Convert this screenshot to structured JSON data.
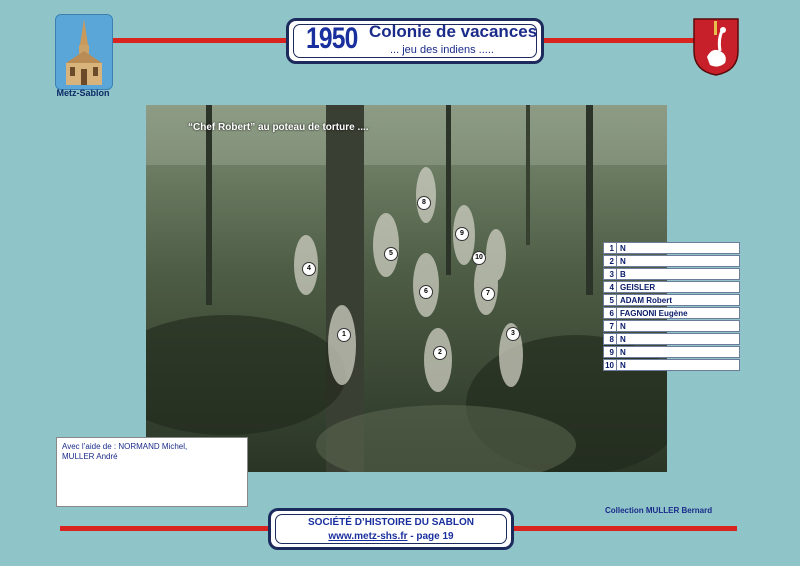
{
  "header": {
    "year": "1950",
    "title": "Colonie de vacances",
    "subtitle": "... jeu des indiens .....",
    "left_logo_caption": "Metz-Sablon"
  },
  "photo": {
    "caption": "“Chef Robert” au poteau de torture ....",
    "markers": [
      "1",
      "2",
      "3",
      "4",
      "5",
      "6",
      "7",
      "8",
      "9",
      "10"
    ]
  },
  "legend": [
    {
      "num": "1",
      "name": "N"
    },
    {
      "num": "2",
      "name": "N"
    },
    {
      "num": "3",
      "name": "B"
    },
    {
      "num": "4",
      "name": "GEISLER"
    },
    {
      "num": "5",
      "name": "ADAM Robert"
    },
    {
      "num": "6",
      "name": "FAGNONI Eugène"
    },
    {
      "num": "7",
      "name": "N"
    },
    {
      "num": "8",
      "name": "N"
    },
    {
      "num": "9",
      "name": "N"
    },
    {
      "num": "10",
      "name": "N"
    }
  ],
  "help": {
    "line1": "Avec l’aide de : NORMAND Michel,",
    "line2": "MULLER André"
  },
  "collection": "Collection MULLER Bernard",
  "footer": {
    "society": "SOCIÉTÉ D’HISTOIRE DU SABLON",
    "url": "www.metz-shs.fr",
    "separator": " - ",
    "page": "page 19"
  },
  "colors": {
    "background": "#8fc4c8",
    "accent_red": "#d8231f",
    "title_blue": "#1a2f9e"
  }
}
